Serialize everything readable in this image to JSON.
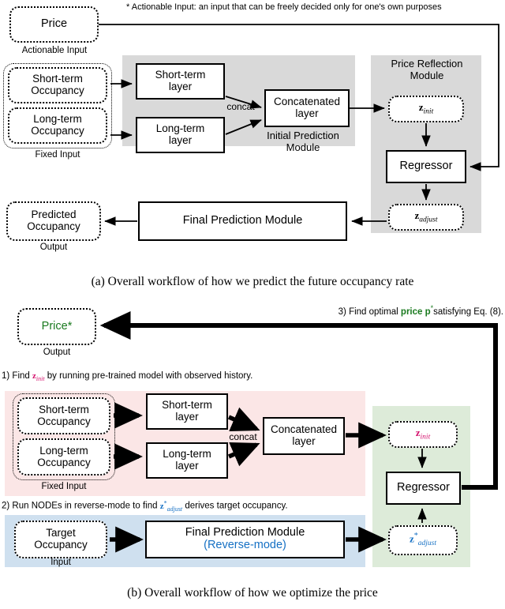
{
  "figure": {
    "footnote": "* Actionable Input: an input that can be freely decided only for one's own purposes",
    "caption_a": "(a)  Overall workflow of how we predict the future occupancy rate",
    "caption_b": "(b)  Overall workflow of how we optimize the price",
    "colors": {
      "gray_module": "#d9d9d9",
      "pink_module": "#fbe6e6",
      "green_module": "#ddebd9",
      "blue_module": "#cfe0ef",
      "green_text": "#1a7a1f",
      "blue_text": "#1570c4",
      "magenta_text": "#d4136e"
    }
  },
  "panel_a": {
    "price_box": "Price",
    "price_label": "Actionable Input",
    "short_term_occupancy": "Short-term\nOccupancy",
    "short_term_occupancy_l1": "Short-term",
    "short_term_occupancy_l2": "Occupancy",
    "long_term_occupancy_l1": "Long-term",
    "long_term_occupancy_l2": "Occupancy",
    "fixed_input_label": "Fixed Input",
    "short_term_layer_l1": "Short-term",
    "short_term_layer_l2": "layer",
    "long_term_layer_l1": "Long-term",
    "long_term_layer_l2": "layer",
    "concat_label": "concat",
    "concatenated_layer_l1": "Concatenated",
    "concatenated_layer_l2": "layer",
    "initial_prediction_module_l1": "Initial Prediction",
    "initial_prediction_module_l2": "Module",
    "price_reflection_module_l1": "Price Reflection",
    "price_reflection_module_l2": "Module",
    "z_init_base": "z",
    "z_init_sub": "init",
    "regressor": "Regressor",
    "z_adjust_base": "z",
    "z_adjust_sub": "adjust",
    "final_prediction_module": "Final Prediction Module",
    "predicted_occupancy_l1": "Predicted",
    "predicted_occupancy_l2": "Occupancy",
    "output_label": "Output"
  },
  "panel_b": {
    "price_star": "Price*",
    "output_label": "Output",
    "step1_pre": "1) Find ",
    "step1_z_base": "z",
    "step1_z_sub": "init",
    "step1_post": " by running pre-trained model with observed history.",
    "step2_pre": "2) Run NODEs in reverse-mode to find ",
    "step2_z_base": "z",
    "step2_z_sub": "adjust",
    "step2_z_sup": "*",
    "step2_post": " derives target occupancy.",
    "step3_pre": "3) Find optimal ",
    "step3_green": "price p",
    "step3_star": "*",
    "step3_post": "satisfying Eq. (8).",
    "short_term_occupancy_l1": "Short-term",
    "short_term_occupancy_l2": "Occupancy",
    "long_term_occupancy_l1": "Long-term",
    "long_term_occupancy_l2": "Occupancy",
    "fixed_input_label": "Fixed Input",
    "short_term_layer_l1": "Short-term",
    "short_term_layer_l2": "layer",
    "long_term_layer_l1": "Long-term",
    "long_term_layer_l2": "layer",
    "concat_label": "concat",
    "concatenated_layer_l1": "Concatenated",
    "concatenated_layer_l2": "layer",
    "z_init_base": "z",
    "z_init_sub": "init",
    "regressor": "Regressor",
    "z_adjust_base": "z",
    "z_adjust_sub": "adjust",
    "z_adjust_sup": "*",
    "target_occupancy_l1": "Target",
    "target_occupancy_l2": "Occupancy",
    "input_label": "Input",
    "final_prediction_module": "Final Prediction Module",
    "reverse_mode": "(Reverse-mode)"
  }
}
